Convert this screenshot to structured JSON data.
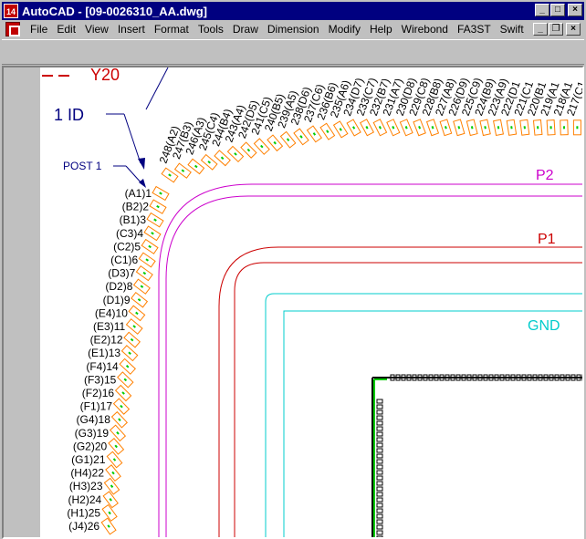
{
  "window": {
    "title": "AutoCAD - [09-0026310_AA.dwg]",
    "app_icon_text": "14"
  },
  "menu": {
    "items": [
      "File",
      "Edit",
      "View",
      "Insert",
      "Format",
      "Tools",
      "Draw",
      "Dimension",
      "Modify",
      "Help",
      "Wirebond",
      "FA3ST",
      "Swift"
    ]
  },
  "drawing": {
    "top_label": "Y20",
    "id_label": "1 ID",
    "post_label": "POST 1",
    "rings": [
      {
        "name": "P2",
        "color": "#cc00cc"
      },
      {
        "name": "P1",
        "color": "#cc0000"
      },
      {
        "name": "GND",
        "color": "#00cccc"
      }
    ],
    "left_pins": [
      "(A1)1",
      "(B2)2",
      "(B1)3",
      "(C3)4",
      "(C2)5",
      "(C1)6",
      "(D3)7",
      "(D2)8",
      "(D1)9",
      "(E4)10",
      "(E3)11",
      "(E2)12",
      "(E1)13",
      "(F4)14",
      "(F3)15",
      "(F2)16",
      "(F1)17",
      "(G4)18",
      "(G3)19",
      "(G2)20",
      "(G1)21",
      "(H4)22",
      "(H3)23",
      "(H2)24",
      "(H1)25",
      "(J4)26"
    ],
    "top_pins": [
      "248(A2)",
      "247(B3)",
      "246(A3)",
      "245(C4)",
      "244(B4)",
      "243(A4)",
      "242(D5)",
      "241(C5)",
      "240(B5)",
      "239(A5)",
      "238(D6)",
      "237(C6)",
      "236(B6)",
      "235(A6)",
      "234(D7)",
      "233(C7)",
      "232(B7)",
      "231(A7)",
      "230(D8)",
      "229(C8)",
      "228(B8)",
      "227(A8)",
      "226(D9)",
      "225(C9)",
      "224(B9)",
      "223(A9)",
      "222(D1",
      "221(C1",
      "220(B1",
      "219(A1",
      "218(A1",
      "217(C1"
    ],
    "colors": {
      "pad_outline": "#ff8000",
      "pad_fill": "#00cc00",
      "label": "#000000",
      "id_label": "#000080"
    }
  }
}
